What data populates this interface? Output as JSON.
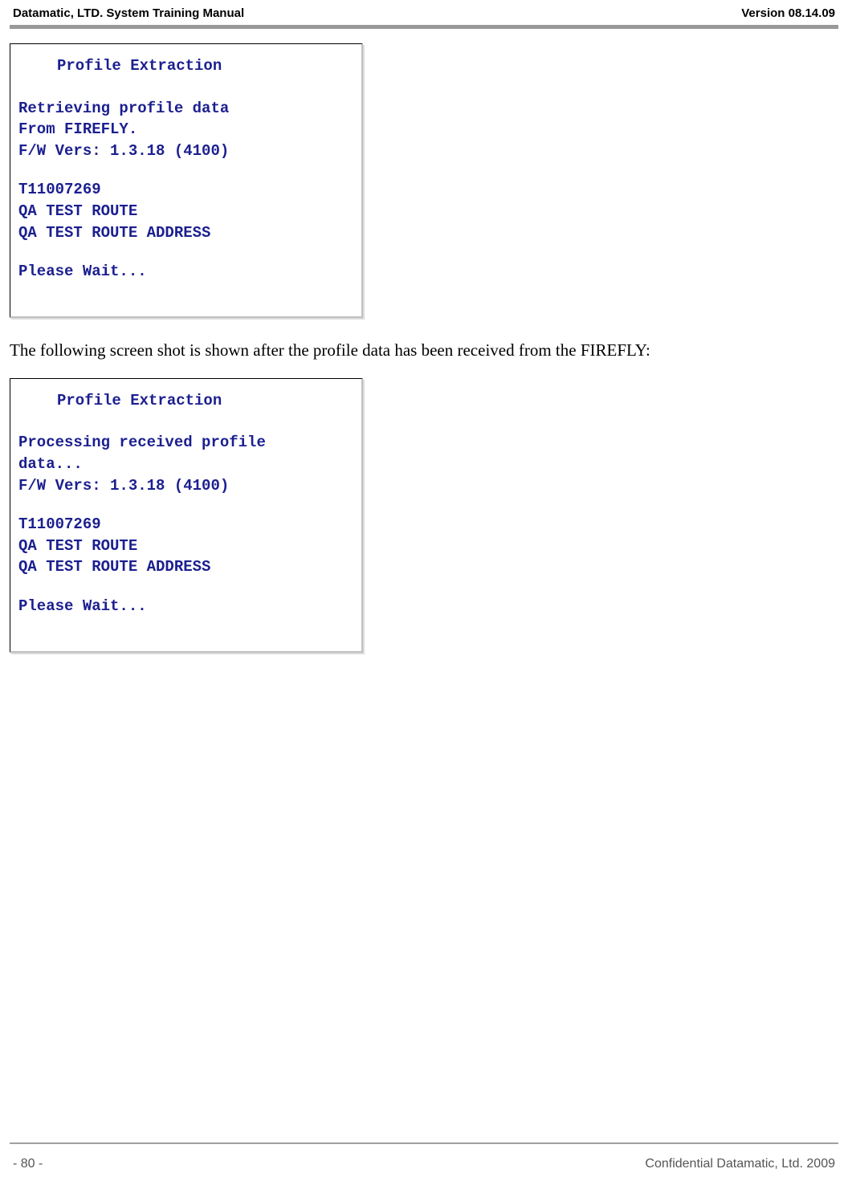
{
  "header": {
    "left": "Datamatic, LTD. System Training  Manual",
    "right": "Version 08.14.09"
  },
  "screenshot1": {
    "title": "Profile Extraction",
    "lines": {
      "l1": "Retrieving profile data",
      "l2": "From FIREFLY.",
      "l3": "F/W Vers: 1.3.18 (4100)",
      "l4": "T11007269",
      "l5": "QA TEST ROUTE",
      "l6": "QA TEST ROUTE ADDRESS",
      "l7": "Please Wait..."
    }
  },
  "paragraph1": "The following screen shot is shown after the profile data has been received from the FIREFLY:",
  "screenshot2": {
    "title": "Profile Extraction",
    "lines": {
      "l1": "Processing received profile",
      "l2": "data...",
      "l3": "F/W Vers: 1.3.18 (4100)",
      "l4": "T11007269",
      "l5": "QA TEST ROUTE",
      "l6": "QA TEST ROUTE ADDRESS",
      "l7": "Please Wait..."
    }
  },
  "footer": {
    "left": "- 80 -",
    "right": "Confidential Datamatic, Ltd. 2009"
  }
}
